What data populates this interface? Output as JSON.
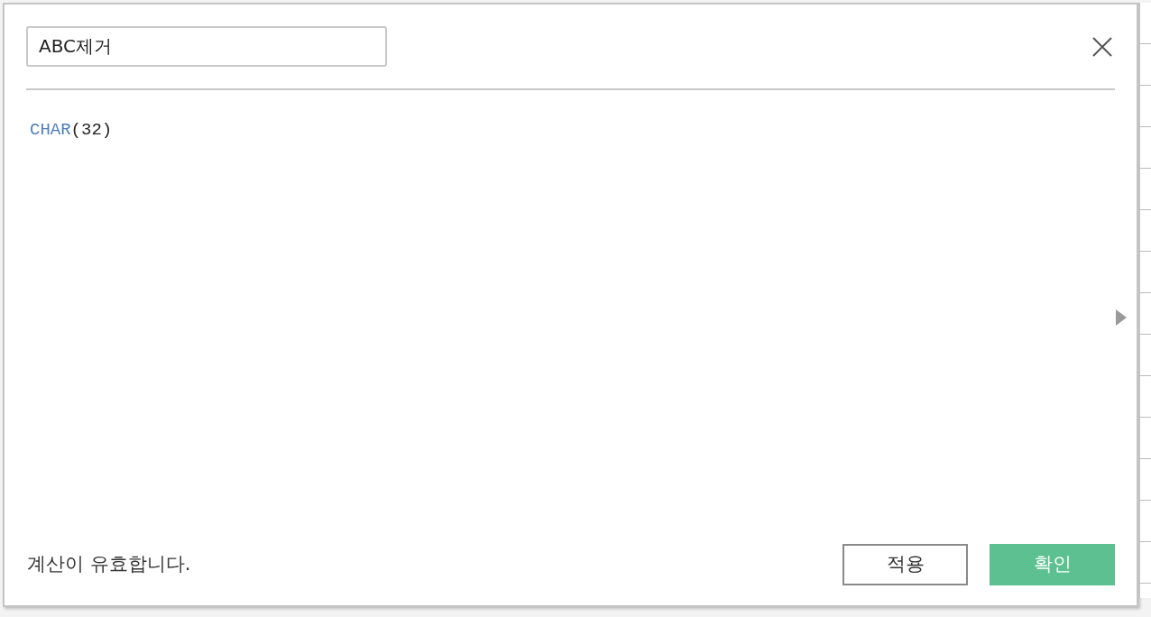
{
  "dialog": {
    "name_field": {
      "value": "ABC제거"
    },
    "formula": [
      {
        "kind": "function",
        "text": "CHAR"
      },
      {
        "kind": "paren",
        "text": "(32)"
      }
    ],
    "status": "계산이 유효합니다.",
    "buttons": [
      {
        "kind": "secondary",
        "label": "적용"
      },
      {
        "kind": "primary",
        "label": "확인"
      }
    ]
  }
}
